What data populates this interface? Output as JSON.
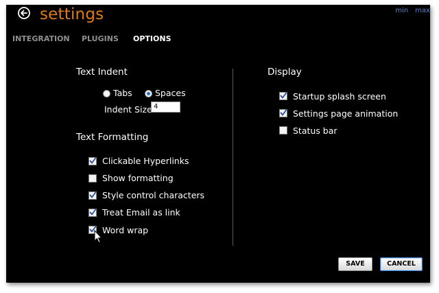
{
  "window": {
    "title": "settings",
    "controls": [
      "min",
      "max"
    ],
    "accent_color": "#e07b16"
  },
  "tabs": [
    {
      "label": "INTEGRATION",
      "active": false
    },
    {
      "label": "PLUGINS",
      "active": false
    },
    {
      "label": "OPTIONS",
      "active": true
    }
  ],
  "text_indent": {
    "title": "Text Indent",
    "radio_options": [
      {
        "label": "Tabs",
        "selected": false
      },
      {
        "label": "Spaces",
        "selected": true
      }
    ],
    "indent_size_label": "Indent Size",
    "indent_size_value": "4"
  },
  "text_formatting": {
    "title": "Text Formatting",
    "options": [
      {
        "label": "Clickable Hyperlinks",
        "checked": true
      },
      {
        "label": "Show formatting",
        "checked": false
      },
      {
        "label": "Style control characters",
        "checked": true
      },
      {
        "label": "Treat Email as link",
        "checked": true
      },
      {
        "label": "Word wrap",
        "checked": true
      }
    ]
  },
  "display": {
    "title": "Display",
    "options": [
      {
        "label": "Startup splash screen",
        "checked": true
      },
      {
        "label": "Settings page animation",
        "checked": true
      },
      {
        "label": "Status bar",
        "checked": false
      }
    ]
  },
  "buttons": {
    "save_label": "SAVE",
    "cancel_label": "CANCEL"
  },
  "icons": {
    "back": "back-arrow-circle-icon",
    "check": "checkmark-icon",
    "cursor": "mouse-pointer-icon"
  }
}
